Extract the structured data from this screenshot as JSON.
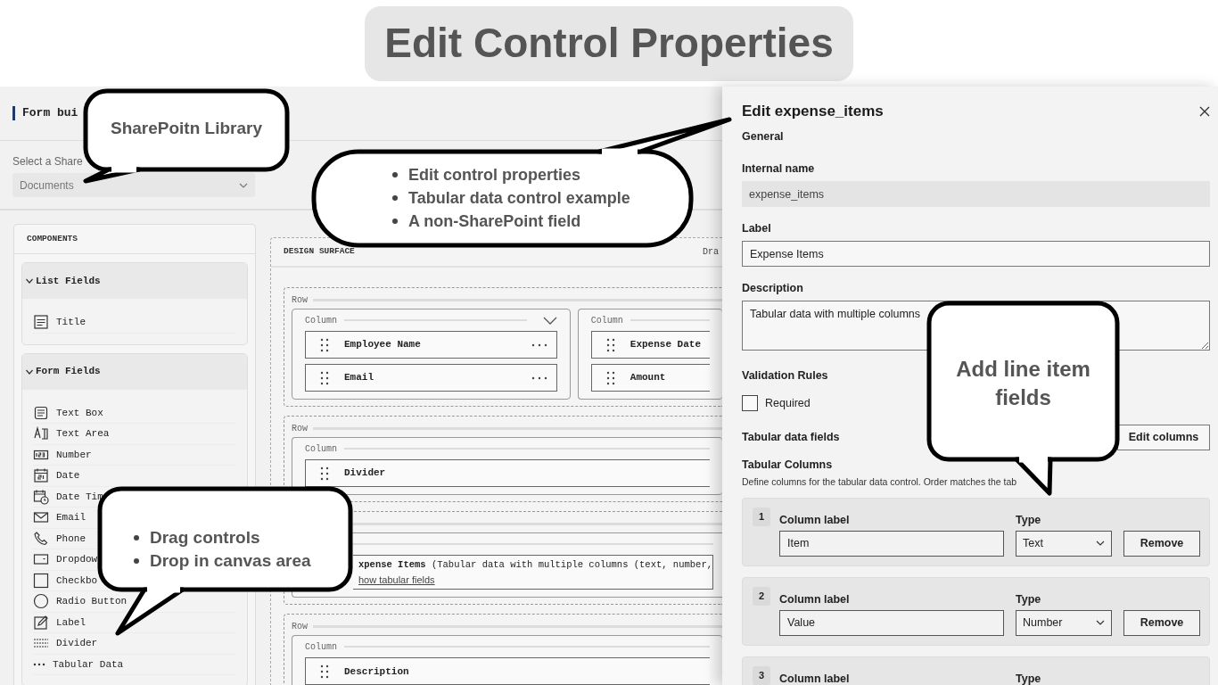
{
  "header": {
    "title": "Edit Control Properties"
  },
  "app": {
    "title": "Form bui",
    "library_label": "Select a Share",
    "library_value": "Documents"
  },
  "components": {
    "heading": "COMPONENTS",
    "groups": [
      {
        "label": "List Fields",
        "expanded": true,
        "items": [
          {
            "kind": "title",
            "label": "Title"
          }
        ]
      },
      {
        "label": "Form Fields",
        "expanded": true,
        "items": [
          {
            "kind": "textbox",
            "label": "Text Box"
          },
          {
            "kind": "textarea",
            "label": "Text Area"
          },
          {
            "kind": "number",
            "label": "Number"
          },
          {
            "kind": "date",
            "label": "Date"
          },
          {
            "kind": "datetime",
            "label": "Date Tim"
          },
          {
            "kind": "email",
            "label": "Email"
          },
          {
            "kind": "phone",
            "label": "Phone"
          },
          {
            "kind": "dropdown",
            "label": "Dropdow"
          },
          {
            "kind": "checkbox",
            "label": "Checkbo"
          },
          {
            "kind": "radio",
            "label": "Radio Button"
          },
          {
            "kind": "label",
            "label": "Label"
          },
          {
            "kind": "divider",
            "label": "Divider"
          },
          {
            "kind": "tabular",
            "label": "Tabular Data"
          }
        ]
      }
    ]
  },
  "design_surface": {
    "heading": "DESIGN SURFACE",
    "hint": "Dra",
    "rows": [
      {
        "label": "Row",
        "columns": [
          {
            "label": "Column",
            "has_toggle": true,
            "fields": [
              {
                "kind": "field",
                "label": "Employee Name",
                "menu": true
              },
              {
                "kind": "field",
                "label": "Email",
                "menu": true
              }
            ]
          },
          {
            "label": "Column",
            "fields": [
              {
                "kind": "field",
                "label": "Expense Date"
              },
              {
                "kind": "field",
                "label": "Amount"
              }
            ]
          }
        ]
      },
      {
        "label": "Row",
        "columns": [
          {
            "label": "Column",
            "fields": [
              {
                "kind": "field",
                "label": "Divider"
              }
            ]
          }
        ]
      },
      {
        "columns": [
          {
            "fields": [
              {
                "kind": "tabular",
                "label": "**xpense Items** (Tabular data with multiple columns (text, number,",
                "link": "how tabular fields"
              }
            ]
          }
        ]
      },
      {
        "label": "Row",
        "columns": [
          {
            "label": "Column",
            "fields": [
              {
                "kind": "field",
                "label": "Description"
              }
            ]
          }
        ]
      }
    ]
  },
  "panel": {
    "title": "Edit expense_items",
    "section": "General",
    "internal_name": {
      "label": "Internal name",
      "value": "expense_items",
      "disabled": true
    },
    "label_field": {
      "label": "Label",
      "value": "Expense Items"
    },
    "description": {
      "label": "Description",
      "value": "Tabular data with multiple columns"
    },
    "validation": {
      "heading": "Validation Rules",
      "label": "Required",
      "checked": false
    },
    "tabular": {
      "label": "Tabular data fields",
      "button": "Edit columns"
    },
    "columns_heading": "Tabular Columns",
    "columns_hint": "Define columns for the tabular data control. Order matches the tab",
    "columns": [
      {
        "number": "1",
        "label_caption": "Column label",
        "value": "Item",
        "type_caption": "Type",
        "type": "Text",
        "remove": "Remove"
      },
      {
        "number": "2",
        "label_caption": "Column label",
        "value": "Value",
        "type_caption": "Type",
        "type": "Number",
        "remove": "Remove"
      },
      {
        "number": "3",
        "label_caption": "Column label",
        "type_caption": "Type"
      }
    ]
  },
  "callouts": [
    {
      "kind": "text",
      "text": "SharePoitn Library"
    },
    {
      "kind": "bullets",
      "items": [
        "Edit control properties",
        "Tabular data control example",
        "A non-SharePoint field"
      ]
    },
    {
      "kind": "bullets",
      "items": [
        "Drag controls",
        "Drop in canvas area"
      ]
    },
    {
      "kind": "text",
      "text": "Add line item fields"
    }
  ]
}
